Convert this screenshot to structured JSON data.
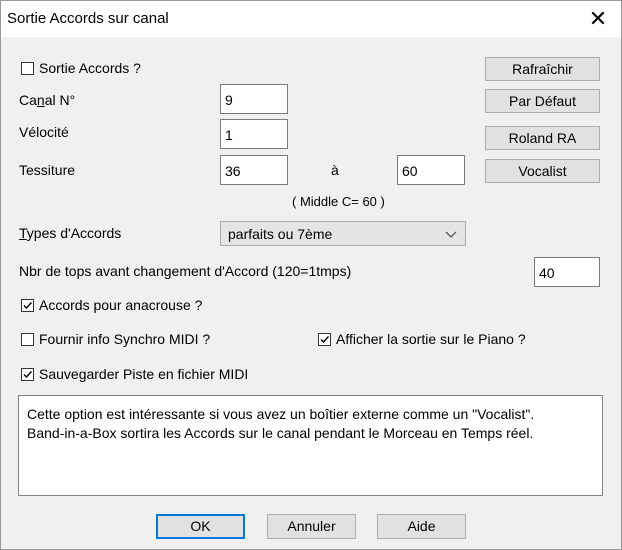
{
  "window": {
    "title": "Sortie Accords sur canal",
    "close_glyph": "✕"
  },
  "output_chords": {
    "label": "Sortie Accords ?",
    "checked": false
  },
  "channel": {
    "label_pre": "Ca",
    "label_ul": "n",
    "label_post": "al N°",
    "value": "9"
  },
  "velocity": {
    "label": "Vélocité",
    "value": "1"
  },
  "range": {
    "label": "Tessiture",
    "low": "36",
    "separator": "à",
    "high": "60",
    "note": "( Middle C= 60 )"
  },
  "chord_types": {
    "label_ul": "T",
    "label_post": "ypes d'Accords",
    "selected": "parfaits ou 7ème"
  },
  "ticks": {
    "label": "Nbr de tops avant changement d'Accord (120=1tmps)",
    "value": "40"
  },
  "pickup": {
    "label": "Accords pour anacrouse ?",
    "checked": true
  },
  "midi_sync": {
    "label": "Fournir info Synchro MIDI ?",
    "checked": false
  },
  "show_piano": {
    "label": "Afficher la sortie sur le Piano ?",
    "checked": true
  },
  "save_track": {
    "label": "Sauvegarder Piste en fichier MIDI",
    "checked": true
  },
  "buttons": {
    "refresh": "Rafraîchir",
    "default": "Par Défaut",
    "roland": "Roland RA",
    "vocalist": "Vocalist",
    "ok": "OK",
    "cancel": "Annuler",
    "help": "Aide"
  },
  "description": "Cette option est intéressante si vous avez un boîtier externe comme un \"Vocalist\".\nBand-in-a-Box  sortira les Accords sur le canal pendant le Morceau en Temps réel."
}
